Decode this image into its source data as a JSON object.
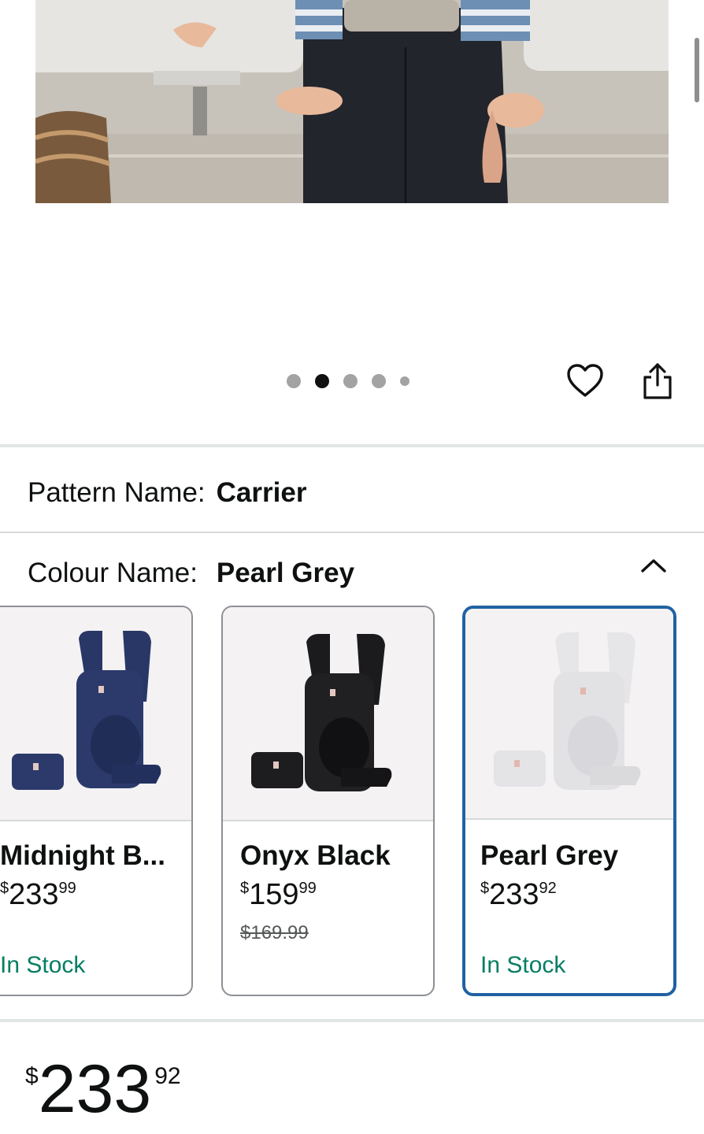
{
  "gallery": {
    "image_alt": "Product photo: adult wearing baby carrier by sink",
    "dots_total": 5,
    "active_dot": 2
  },
  "actions": {
    "wishlist_icon": "heart-icon",
    "share_icon": "share-icon"
  },
  "pattern": {
    "label": "Pattern Name:",
    "value": "Carrier"
  },
  "colour": {
    "label": "Colour Name:",
    "value": "Pearl Grey",
    "collapse_icon": "chevron-up-icon",
    "options": [
      {
        "name": "Midnight B...",
        "price_symbol": "$",
        "price_whole": "233",
        "price_fraction": "99",
        "list_price": "",
        "stock": "In Stock",
        "color": "#2b3a67",
        "selected": false
      },
      {
        "name": "Onyx Black",
        "price_symbol": "$",
        "price_whole": "159",
        "price_fraction": "99",
        "list_price": "$169.99",
        "stock": "",
        "color": "#1a1a1a",
        "selected": false
      },
      {
        "name": "Pearl Grey",
        "price_symbol": "$",
        "price_whole": "233",
        "price_fraction": "92",
        "list_price": "",
        "stock": "In Stock",
        "color": "#e3e3e5",
        "selected": true
      }
    ]
  },
  "main_price": {
    "symbol": "$",
    "whole": "233",
    "fraction": "92"
  },
  "colors": {
    "in_stock": "#067d62",
    "selected_border": "#2162a1"
  }
}
